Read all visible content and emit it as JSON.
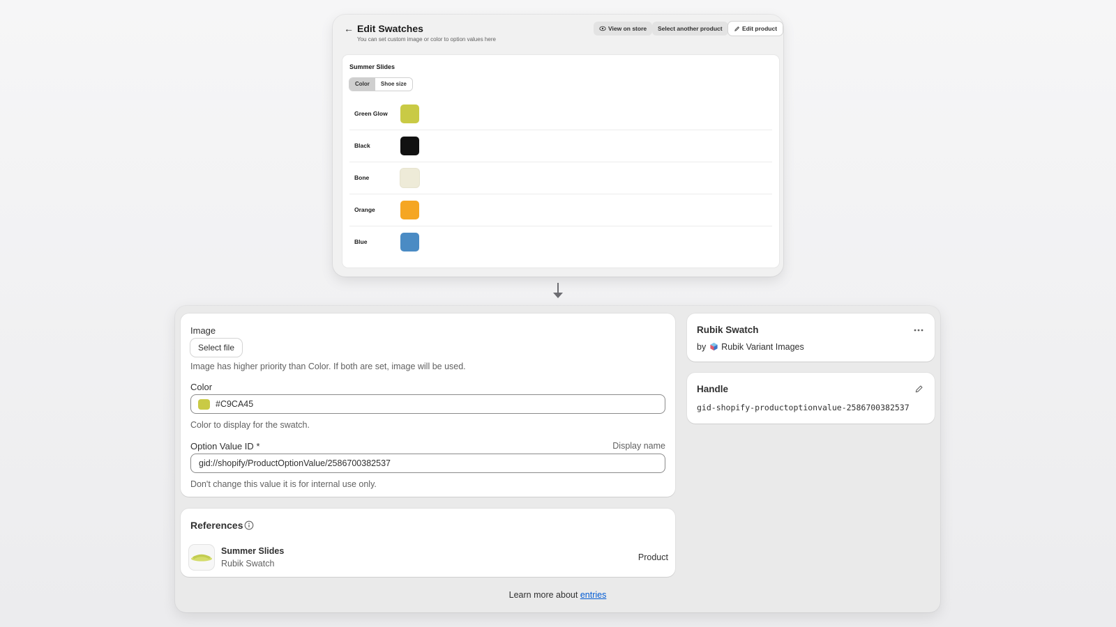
{
  "top": {
    "back_icon": "arrow-left-icon",
    "title": "Edit Swatches",
    "subtitle": "You can set custom image or color to option values here",
    "buttons": {
      "view_on_store": "View on store",
      "select_another": "Select another product",
      "edit_product": "Edit product"
    },
    "product_name": "Summer Slides",
    "tabs": [
      {
        "label": "Color",
        "active": true
      },
      {
        "label": "Shoe size",
        "active": false
      }
    ],
    "swatches": [
      {
        "name": "Green Glow",
        "color": "#C9CA45"
      },
      {
        "name": "Black",
        "color": "#111111"
      },
      {
        "name": "Bone",
        "color": "#EEEBD8"
      },
      {
        "name": "Orange",
        "color": "#F5A623"
      },
      {
        "name": "Blue",
        "color": "#4A8BC4"
      }
    ]
  },
  "form": {
    "image_label": "Image",
    "select_file": "Select file",
    "image_help": "Image has higher priority than Color. If both are set, image will be used.",
    "color_label": "Color",
    "color_value": "#C9CA45",
    "color_help": "Color to display for the swatch.",
    "option_label": "Option Value ID",
    "required_mark": "*",
    "display_name": "Display name",
    "option_value": "gid://shopify/ProductOptionValue/2586700382537",
    "option_help": "Don't change this value it is for internal use only."
  },
  "references": {
    "title": "References",
    "item_title": "Summer Slides",
    "item_sub": "Rubik Swatch",
    "item_type": "Product"
  },
  "app_card": {
    "title": "Rubik Swatch",
    "by": "by",
    "app_name": "Rubik Variant Images"
  },
  "handle_card": {
    "title": "Handle",
    "value": "gid-shopify-productoptionvalue-2586700382537"
  },
  "footer": {
    "prefix": "Learn more about",
    "link": "entries"
  }
}
